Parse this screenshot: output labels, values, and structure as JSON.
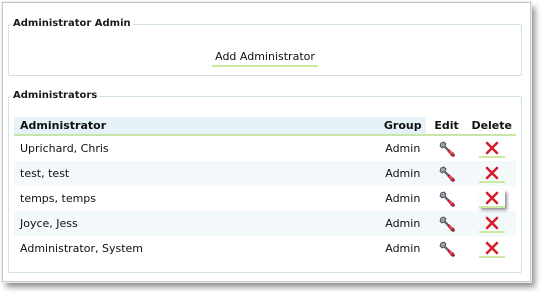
{
  "admin_section": {
    "legend": "Administrator Admin",
    "add_label": "Add Administrator"
  },
  "list_section": {
    "legend": "Administrators",
    "columns": {
      "administrator": "Administrator",
      "group": "Group",
      "edit": "Edit",
      "delete": "Delete"
    },
    "rows": [
      {
        "name": "Uprichard, Chris",
        "group": "Admin"
      },
      {
        "name": "test, test",
        "group": "Admin"
      },
      {
        "name": "temps, temps",
        "group": "Admin"
      },
      {
        "name": "Joyce, Jess",
        "group": "Admin"
      },
      {
        "name": "Administrator, System",
        "group": "Admin"
      }
    ]
  },
  "icons": {
    "edit": "wrench-icon",
    "delete": "red-x-icon"
  },
  "colors": {
    "header_bg": "#e7f1f8",
    "underline_green": "#c9e6a8",
    "delete_red": "#d4202a",
    "fieldset_border": "#cfe0e8"
  }
}
